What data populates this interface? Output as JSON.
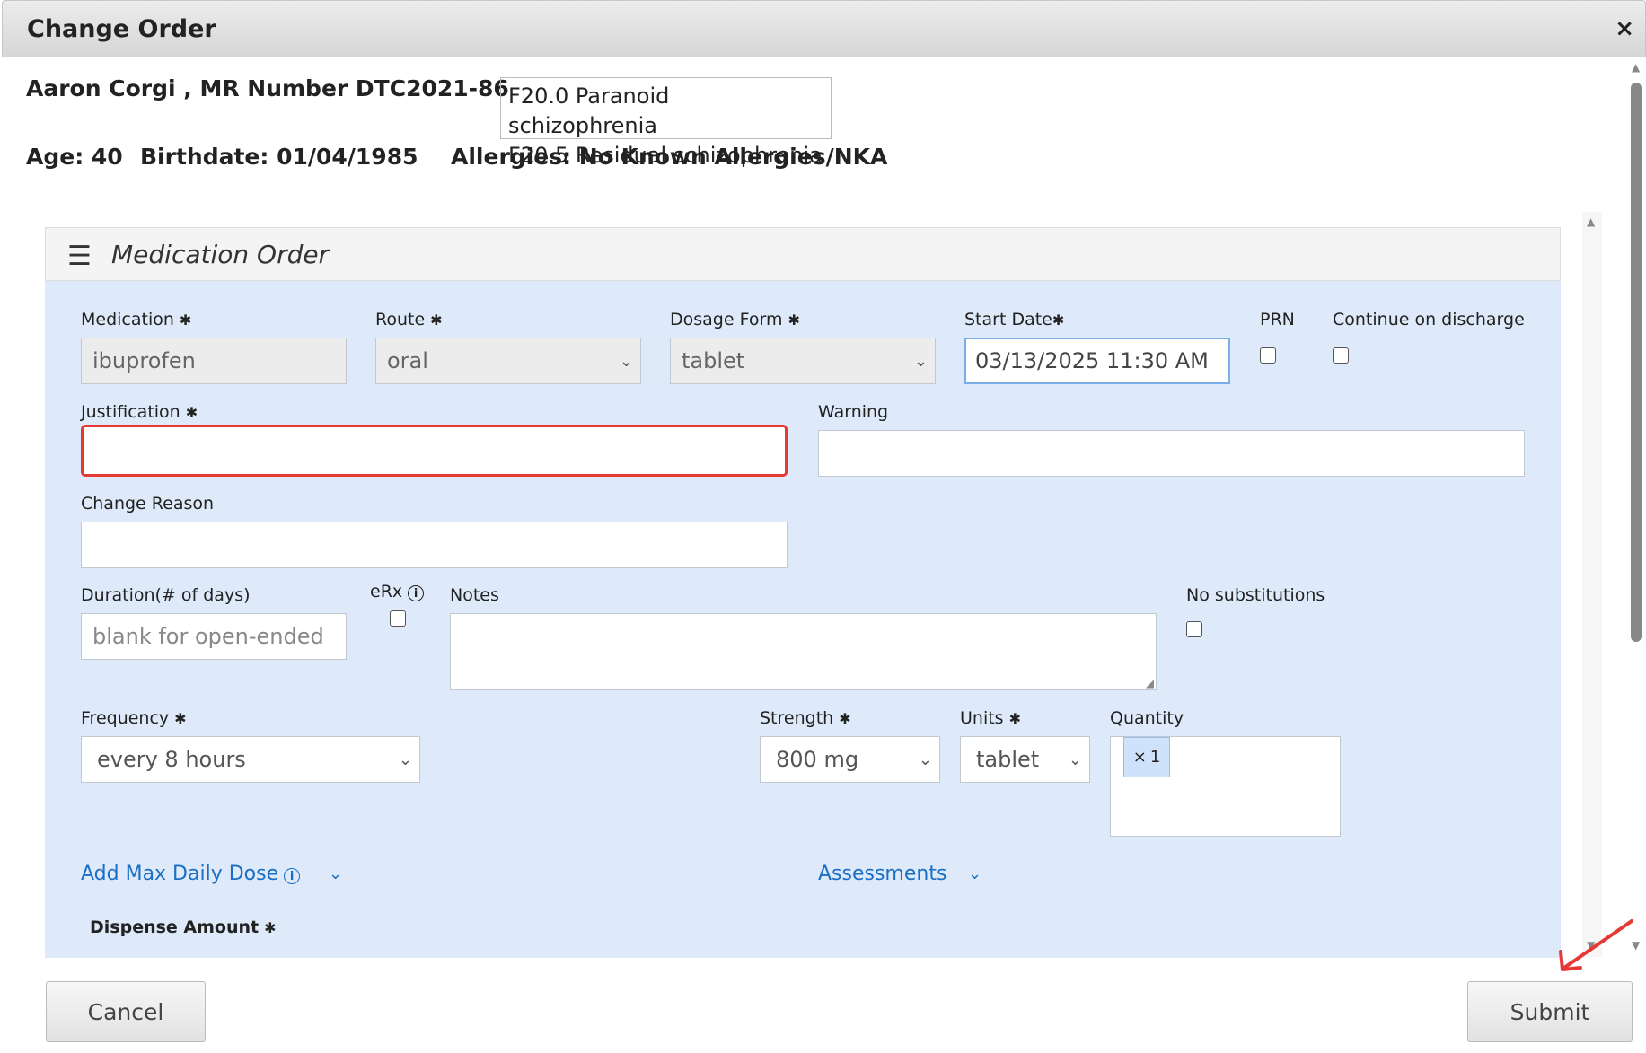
{
  "dialog": {
    "title": "Change Order",
    "close_glyph": "×"
  },
  "patient": {
    "name_line": "Aaron Corgi , MR Number DTC2021-86",
    "diagnoses": [
      "F20.0 Paranoid schizophrenia",
      "F20.5 Residual schizophrenia"
    ],
    "age": "Age: 40",
    "birthdate": "Birthdate: 01/04/1985",
    "allergies": "Allergies: No Known Allergies/NKA"
  },
  "panel": {
    "title": "Medication Order"
  },
  "form": {
    "required_mark": "✱",
    "medication": {
      "label": "Medication",
      "value": "ibuprofen"
    },
    "route": {
      "label": "Route",
      "value": "oral"
    },
    "dosage_form": {
      "label": "Dosage Form",
      "value": "tablet"
    },
    "start_date": {
      "label": "Start Date",
      "value": "03/13/2025 11:30 AM"
    },
    "prn": {
      "label": "PRN"
    },
    "continue_discharge": {
      "label": "Continue on discharge"
    },
    "justification": {
      "label": "Justification",
      "value": ""
    },
    "warning": {
      "label": "Warning",
      "value": ""
    },
    "change_reason": {
      "label": "Change Reason",
      "value": ""
    },
    "duration": {
      "label": "Duration(# of days)",
      "placeholder": "blank for open-ended"
    },
    "erx": {
      "label": "eRx"
    },
    "notes": {
      "label": "Notes",
      "value": ""
    },
    "no_substitutions": {
      "label": "No substitutions"
    },
    "frequency": {
      "label": "Frequency",
      "value": "every 8 hours"
    },
    "strength": {
      "label": "Strength",
      "value": "800 mg"
    },
    "units": {
      "label": "Units",
      "value": "tablet"
    },
    "quantity": {
      "label": "Quantity",
      "tag": "1",
      "tag_remove": "×"
    },
    "add_max_daily_dose": "Add Max Daily Dose",
    "assessments": "Assessments",
    "dispense_amount": {
      "label": "Dispense Amount"
    }
  },
  "footer": {
    "cancel": "Cancel",
    "submit": "Submit"
  },
  "colors": {
    "error_border": "#e53935",
    "link": "#1a6fc4",
    "panel_bg": "#deeafa",
    "annotation_arrow": "#e53935"
  }
}
